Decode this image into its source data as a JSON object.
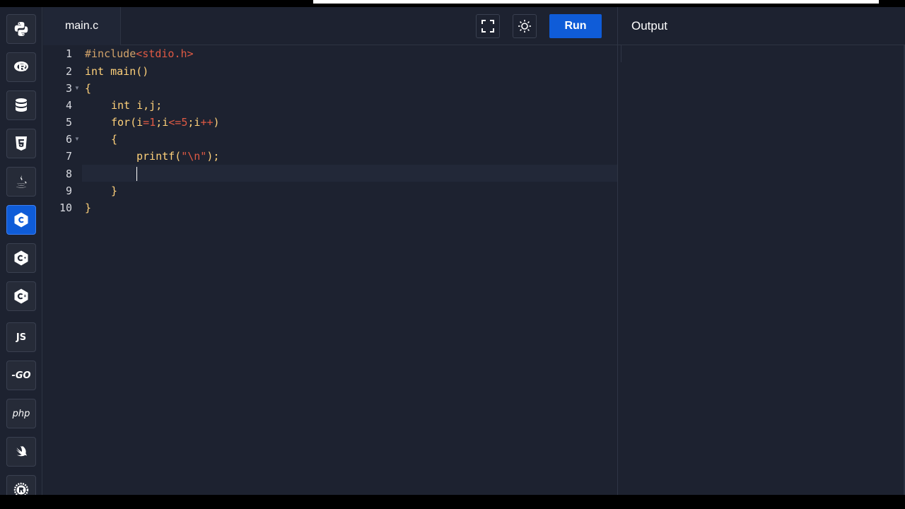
{
  "editor": {
    "file_name": "main.c",
    "line_numbers": [
      "1",
      "2",
      "3",
      "4",
      "5",
      "6",
      "7",
      "8",
      "9",
      "10"
    ],
    "code": {
      "l1_directive": "#include",
      "l1_header": "<stdio.h>",
      "l2": "int main()",
      "l3": "{",
      "l4_kw": "int",
      "l4_rest": " i,j;",
      "l5_for": "for",
      "l5_a": "(i",
      "l5_eq": "=",
      "l5_one": "1",
      "l5_b": ";i",
      "l5_le": "<=",
      "l5_five": "5",
      "l5_c": ";i",
      "l5_inc": "++",
      "l5_d": ")",
      "l6": "{",
      "l7_fn": "printf",
      "l7_open": "(",
      "l7_str": "\"\\n\"",
      "l7_close": ");",
      "l8": "",
      "l9": "}",
      "l10": "}"
    },
    "cursor_line": 8
  },
  "header": {
    "run_label": "Run",
    "output_title": "Output"
  },
  "sidebar": {
    "items": [
      {
        "name": "python-icon"
      },
      {
        "name": "r-icon"
      },
      {
        "name": "sql-database-icon"
      },
      {
        "name": "html5-icon",
        "label": "5"
      },
      {
        "name": "java-icon"
      },
      {
        "name": "c-icon",
        "label": "C",
        "active": true
      },
      {
        "name": "cpp-icon",
        "label": "C"
      },
      {
        "name": "csharp-icon",
        "label": "C"
      },
      {
        "name": "javascript-icon",
        "label": "JS"
      },
      {
        "name": "go-icon",
        "label": "-GO"
      },
      {
        "name": "php-icon",
        "label": "php"
      },
      {
        "name": "swift-icon"
      },
      {
        "name": "rust-icon"
      }
    ]
  },
  "colors": {
    "background": "#1d2230",
    "accent": "#0f5cd8",
    "keyword": "#ffd17a",
    "literal": "#e05a44"
  }
}
